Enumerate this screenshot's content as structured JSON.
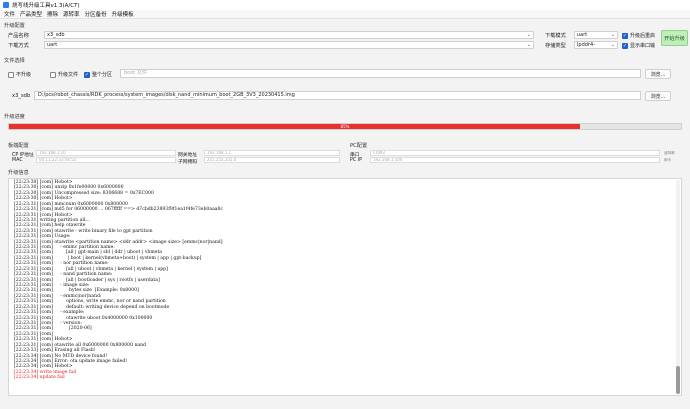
{
  "window": {
    "title": "烧写线升级工具v1.3(A/CT)"
  },
  "menu": [
    "文件",
    "产品类型",
    "擦除",
    "源转率",
    "分区备份",
    "升级模板"
  ],
  "upgrade_config": {
    "section_label": "升级配置",
    "product_name_label": "产品名称",
    "product_name_value": "x3_sdb",
    "download_mode_label": "下载方式",
    "download_mode_value": "uart",
    "dl_mode_label": "下载模式",
    "dl_mode_value": "uart",
    "storage_type_label": "存储类型",
    "storage_type_value": "lpddr4-samsung",
    "check_restart_label": "升级后重启",
    "check_serial_label": "显示串口输",
    "start_button": "开始升级"
  },
  "file_select": {
    "section_label": "文件选择",
    "cb_no_upgrade": "不升级",
    "cb_upgrade_file": "升级文件",
    "cb_all_partition": "整个分区",
    "boot_file_placeholder": "boot 文件",
    "browse_label": "浏览...",
    "file_label": "x3_sdb",
    "file_path": "D:/pcs/robot_chassis/RDK_process/system_images/disk_nand_minimum_boot_2GB_3V3_20230415.img"
  },
  "progress": {
    "section_label": "升级进度",
    "percent": 85,
    "text": "85%"
  },
  "board_config": {
    "section_label": "板端配置",
    "cp_ip_label": "CP IP地址",
    "cp_ip_value": "192.168.1.10",
    "gateway_label": "网关地址",
    "gateway_value": "192.168.1.1",
    "mac_label": "MAC",
    "mac_value": "00:11:22:33:44:55",
    "netmask_label": "子网掩码",
    "netmask_value": "255.255.255.0"
  },
  "pc_config": {
    "section_label": "PC配置",
    "port_label": "串口",
    "port_value": "COM3",
    "pc_ip_label": "PC IP",
    "pc_ip_value": "192.168.1.100",
    "note1": "波特率",
    "note2": "网卡"
  },
  "log": {
    "section_label": "升级信息",
    "lines": [
      {
        "t": "[22:23:30] [com] Hobot>",
        "err": false
      },
      {
        "t": "[22:23:30] [com] unzip 0x1fe00000 0x6000000",
        "err": false
      },
      {
        "t": "[22:23:30] [com] Uncompressed size: 8306688 = 0x7EC000",
        "err": false
      },
      {
        "t": "[22:23:30] [com] Hobot>",
        "err": false
      },
      {
        "t": "[22:23:31] [com] mmcnum 0x6000000 0x800000",
        "err": false
      },
      {
        "t": "[22:23:31] [com] md5 for 06000000 ... 067fffff ==> d7cbdb23893f9f1ea1f4fe73eb0aaa8c",
        "err": false
      },
      {
        "t": "[22:23:31] [com] Hobot>",
        "err": false
      },
      {
        "t": "[22:23:31] writing partition all...",
        "err": false
      },
      {
        "t": "[22:23:31] [com] help otawrite",
        "err": false
      },
      {
        "t": "[22:23:31] [com] otawrite - write binary file to gpt partition",
        "err": false
      },
      {
        "t": "[22:23:31] [com] Usage:",
        "err": false
      },
      {
        "t": "[22:23:31] [com] otawrite <partition name> <ddr addr> <image size> [emmc|nor|nand]",
        "err": false
      },
      {
        "t": "[22:23:31] [com]     - emmc partition name:",
        "err": false
      },
      {
        "t": "[22:23:31] [com]         [all | gpt-main | sbl | ddr | uboot | vbmeta",
        "err": false
      },
      {
        "t": "[22:23:31] [com]          | boot | kernel(vbmeta+boot) | system | app | gpt-backup]",
        "err": false
      },
      {
        "t": "[22:23:31] [com]     - nor partition name:",
        "err": false
      },
      {
        "t": "[22:23:31] [com]         [all | uboot | vbmeta | kernel | system | app]",
        "err": false
      },
      {
        "t": "[22:23:31] [com]     - nand partition name:",
        "err": false
      },
      {
        "t": "[22:23:31] [com]         [all | bootloader | sys | rootfs | userdata]",
        "err": false
      },
      {
        "t": "[22:23:31] [com]     - image size:",
        "err": false
      },
      {
        "t": "[22:23:31] [com]           bytes size  [Example: 0x8000]",
        "err": false
      },
      {
        "t": "[22:23:31] [com]     - emmc|nor|nand:",
        "err": false
      },
      {
        "t": "[22:23:31] [com]         options, write emmc, nor or nand partition",
        "err": false
      },
      {
        "t": "[22:23:31] [com]         default: writing device depend on bootmode",
        "err": false
      },
      {
        "t": "[22:23:31] [com]     - example:",
        "err": false
      },
      {
        "t": "[22:23:31] [com]         otawrite uboot 0x4000000 0x100000",
        "err": false
      },
      {
        "t": "[22:23:31] [com]     - version:",
        "err": false
      },
      {
        "t": "[22:23:31] [com]           [2020-06]",
        "err": false
      },
      {
        "t": "[22:23:31] [com]",
        "err": false
      },
      {
        "t": "[22:23:31] [com] Hobot>",
        "err": false
      },
      {
        "t": "[22:23:31] [com] otawrite all 0x6000000 0x800000 nand",
        "err": false
      },
      {
        "t": "[22:23:33] [com] Erasing all Flash!",
        "err": false
      },
      {
        "t": "[22:23:34] [com] No MTD device found!",
        "err": false
      },
      {
        "t": "[22:23:34] [com] Error: ota update image failed!",
        "err": false
      },
      {
        "t": "[22:23:34] [com] Hobot>",
        "err": false
      },
      {
        "t": "[22:23:34] write image fail",
        "err": true
      },
      {
        "t": "[22:23:34] update fail",
        "err": true
      }
    ]
  }
}
